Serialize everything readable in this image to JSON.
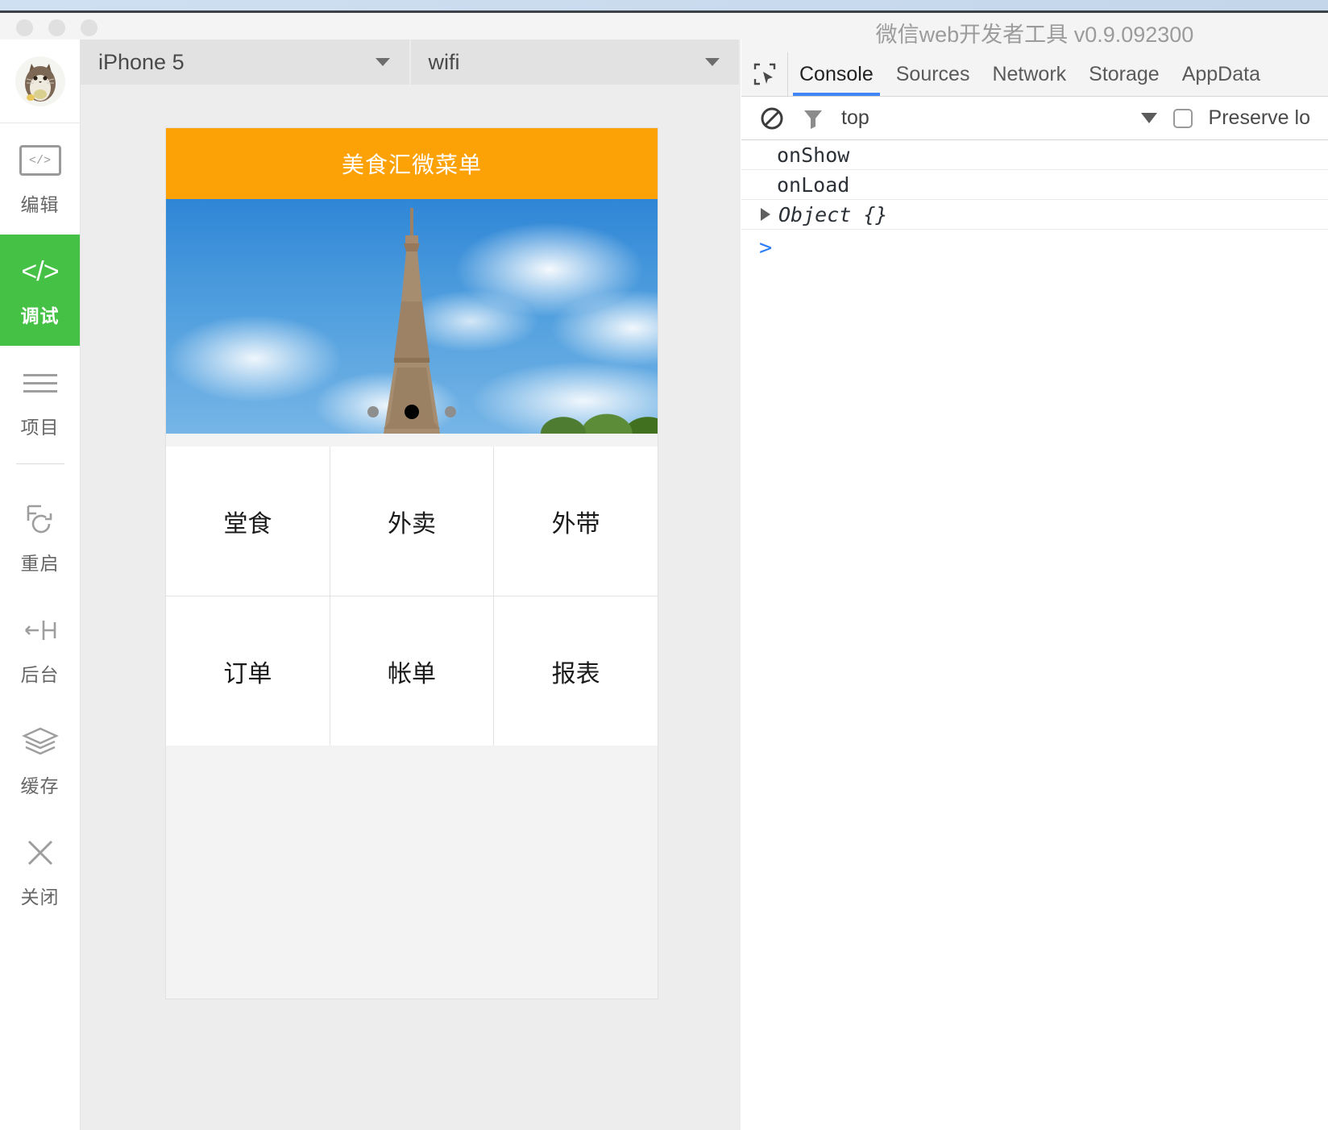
{
  "window": {
    "traffic_lights": [
      "close",
      "minimize",
      "zoom"
    ]
  },
  "sidebar": {
    "avatar_name": "totoro-avatar",
    "items": [
      {
        "label": "编辑",
        "icon": "code-box-icon",
        "active": false
      },
      {
        "label": "调试",
        "icon": "code-slash-icon",
        "active": true
      },
      {
        "label": "项目",
        "icon": "hamburger-icon",
        "active": false
      },
      {
        "label": "重启",
        "icon": "restart-icon",
        "active": false
      },
      {
        "label": "后台",
        "icon": "background-icon",
        "active": false
      },
      {
        "label": "缓存",
        "icon": "layers-icon",
        "active": false
      },
      {
        "label": "关闭",
        "icon": "close-x-icon",
        "active": false
      }
    ]
  },
  "simulator": {
    "device_select": {
      "value": "iPhone 5"
    },
    "network_select": {
      "value": "wifi"
    },
    "miniprogram": {
      "header_title": "美食汇微菜单",
      "header_color": "#fca106",
      "carousel": {
        "image_alt": "eiffel-tower-photo",
        "dots": 3,
        "active_dot_index": 1
      },
      "grid": [
        [
          "堂食",
          "外卖",
          "外带"
        ],
        [
          "订单",
          "帐单",
          "报表"
        ]
      ]
    }
  },
  "devtools": {
    "title": "微信web开发者工具 v0.9.092300",
    "tabs": [
      {
        "label": "Console",
        "active": true
      },
      {
        "label": "Sources",
        "active": false
      },
      {
        "label": "Network",
        "active": false
      },
      {
        "label": "Storage",
        "active": false
      },
      {
        "label": "AppData",
        "active": false
      }
    ],
    "accent_color": "#4285f4",
    "filterbar": {
      "clear_icon": "clear-console-icon",
      "filter_icon": "filter-funnel-icon",
      "context": "top",
      "preserve_log_label": "Preserve lo"
    },
    "console_logs": [
      {
        "text": "onShow",
        "expandable": false
      },
      {
        "text": "onLoad",
        "expandable": false
      },
      {
        "text": "Object {}",
        "expandable": true
      }
    ],
    "prompt": ">"
  }
}
